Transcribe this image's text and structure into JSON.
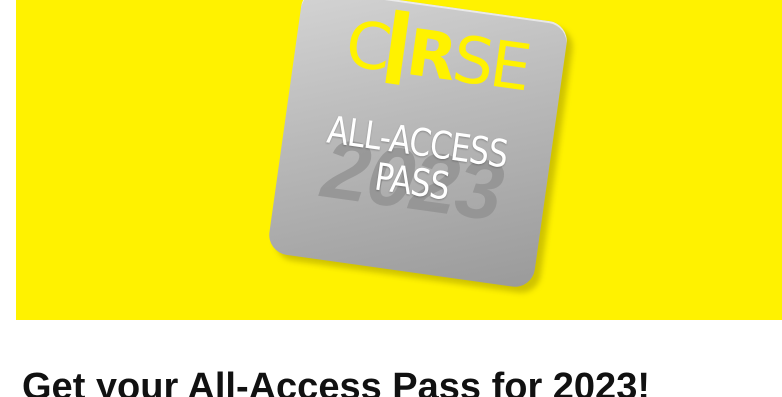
{
  "hero": {
    "background_color": "#fff200",
    "badge": {
      "brand_prefix": "C",
      "brand_bold": "R",
      "brand_suffix": "SE",
      "line1": "ALL-ACCESS",
      "line2": "PASS",
      "year": "2023",
      "card_color": "#b9b9b9",
      "text_color": "#fff200"
    }
  },
  "main": {
    "headline": "Get your All-Access Pass for 2023!"
  }
}
